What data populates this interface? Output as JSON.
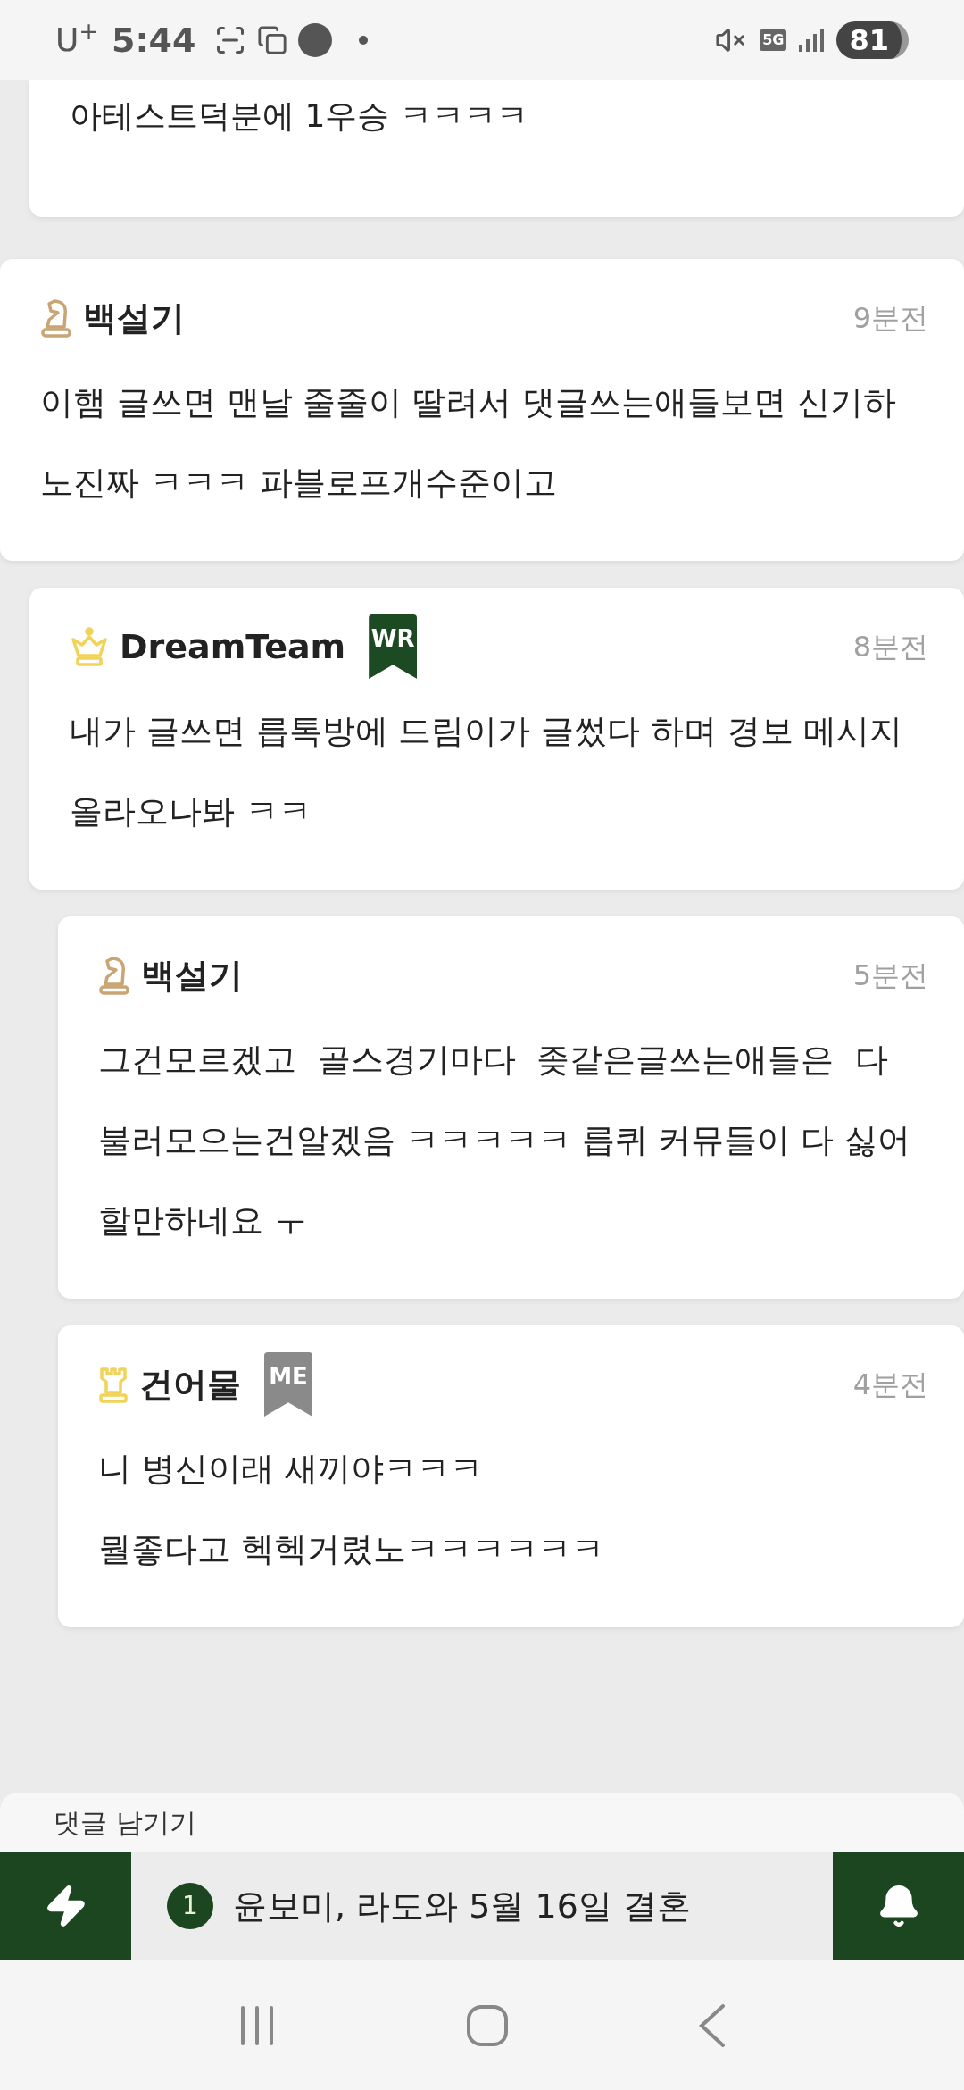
{
  "status_bar": {
    "carrier": "U$^{+}$",
    "time": "5:44",
    "network": "5G",
    "battery": "81"
  },
  "earlier_reply": {
    "text": "아테스트덕분에 1우승 ㅋㅋㅋㅋ"
  },
  "comments": [
    {
      "author": "백설기",
      "kind": "knight",
      "time": "9분전",
      "text": "이햄 글쓰면 맨날 줄줄이 딸려서 댓글쓰는애들보면 신기하노진짜 ㅋㅋㅋ 파블로프개수준이고",
      "children": [
        {
          "author": "DreamTeam",
          "kind": "crown",
          "badge": {
            "label": "WR",
            "kind": "writer"
          },
          "time": "8분전",
          "text": "내가 글쓰면 릅톡방에 드림이가 글썼다 하며 경보 메시지 올라오나봐 ㅋㅋ",
          "children": [
            {
              "author": "백설기",
              "kind": "knight",
              "time": "5분전",
              "text": "그건모르겠고  골스경기마다  좆같은글쓰는애들은  다 불러모으는건알겠음 ㅋㅋㅋㅋㅋ 릅퀴 커뮤들이 다 싫어할만하네요 ㅜ"
            },
            {
              "author": "건어물",
              "kind": "rook",
              "badge": {
                "label": "ME",
                "kind": "me"
              },
              "time": "4분전",
              "text": "니 병신이래 새끼야ㅋㅋㅋ\n뭘좋다고 헥헥거렸노ㅋㅋㅋㅋㅋㅋ"
            }
          ]
        }
      ]
    }
  ],
  "comment_box": {
    "placeholder": "댓글 남기기"
  },
  "news_ticker": {
    "rank": "1",
    "headline": "윤보미, 라도와 5월 16일 결혼"
  }
}
